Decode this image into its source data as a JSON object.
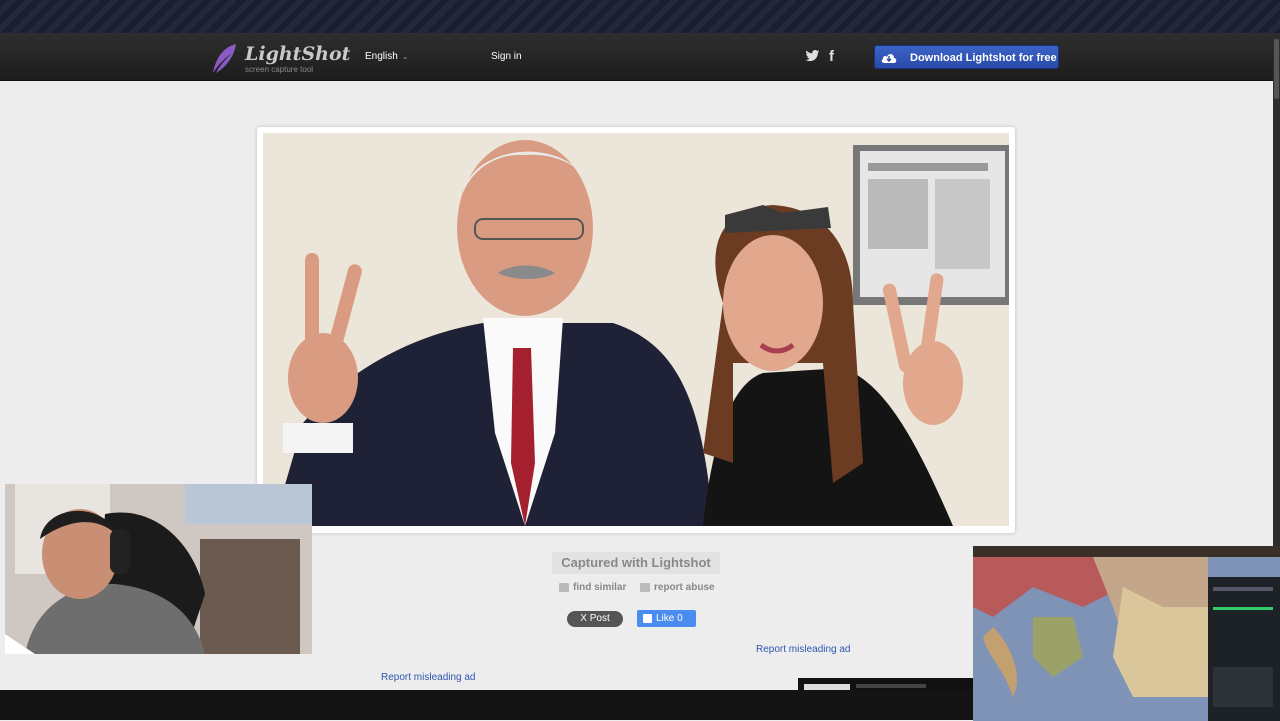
{
  "brand": {
    "title": "LightShot",
    "subtitle": "screen capture tool"
  },
  "nav": {
    "language": "English",
    "language_chevron": "⌄",
    "signin": "Sign in",
    "facebook_glyph": "f",
    "download_button": "Download Lightshot for free"
  },
  "screenshot": {
    "alt": "Two people smiling and making victory signs in an office"
  },
  "captured_label": "Captured with Lightshot",
  "actions": {
    "find_similar": "find similar",
    "report_abuse": "report abuse"
  },
  "social": {
    "post": "Post",
    "post_prefix": "X",
    "like": "Like",
    "like_count": "0"
  },
  "report_ads": [
    "Report misleading ad",
    "Report misleading ad"
  ],
  "colors": {
    "accent": "#2a4aa8",
    "link": "#2e57b3",
    "fb_like": "#4a8cf0",
    "nav_bg": "#232323",
    "page_bg": "#ededed"
  },
  "icons": [
    "feather-icon",
    "twitter-icon",
    "facebook-icon",
    "download-cloud-icon",
    "camera-icon",
    "flag-icon",
    "thumbs-up-icon"
  ]
}
